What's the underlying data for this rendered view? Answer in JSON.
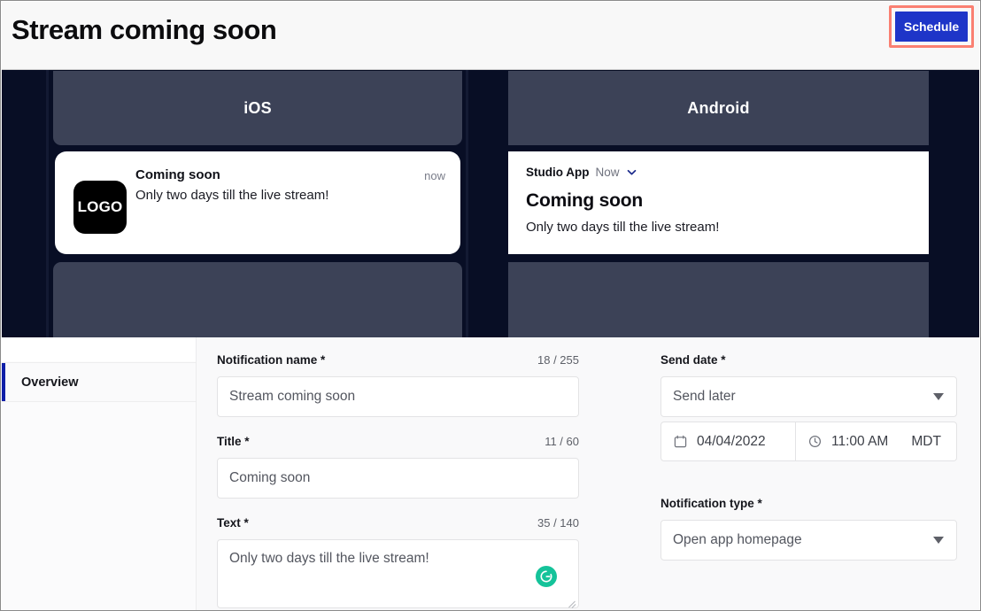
{
  "header": {
    "title": "Stream coming soon",
    "schedule_label": "Schedule"
  },
  "preview": {
    "ios": {
      "device_name": "iOS",
      "logo_text": "LOGO",
      "title": "Coming soon",
      "time": "now",
      "body": "Only two days till the live stream!"
    },
    "android": {
      "device_name": "Android",
      "app_name": "Studio App",
      "time": "Now",
      "title": "Coming soon",
      "body": "Only two days till the live stream!"
    }
  },
  "sidebar": {
    "items": [
      {
        "label": "Overview"
      }
    ]
  },
  "form": {
    "notification_name": {
      "label": "Notification name *",
      "counter": "18 / 255",
      "value": "Stream coming soon"
    },
    "title": {
      "label": "Title *",
      "counter": "11 / 60",
      "value": "Coming soon"
    },
    "text": {
      "label": "Text *",
      "counter": "35 / 140",
      "value": "Only two days till the live stream!"
    },
    "send_date": {
      "label": "Send date *",
      "mode": "Send later",
      "date": "04/04/2022",
      "time": "11:00 AM",
      "timezone": "MDT"
    },
    "notification_type": {
      "label": "Notification type *",
      "value": "Open app homepage"
    }
  },
  "colors": {
    "accent_blue": "#1e35c8",
    "highlight_ring": "#fa8072",
    "stage_bg": "#080e25",
    "device_panel": "#3c4257",
    "nav_active": "#0f1fa8",
    "grammarly_green": "#15c39a"
  }
}
